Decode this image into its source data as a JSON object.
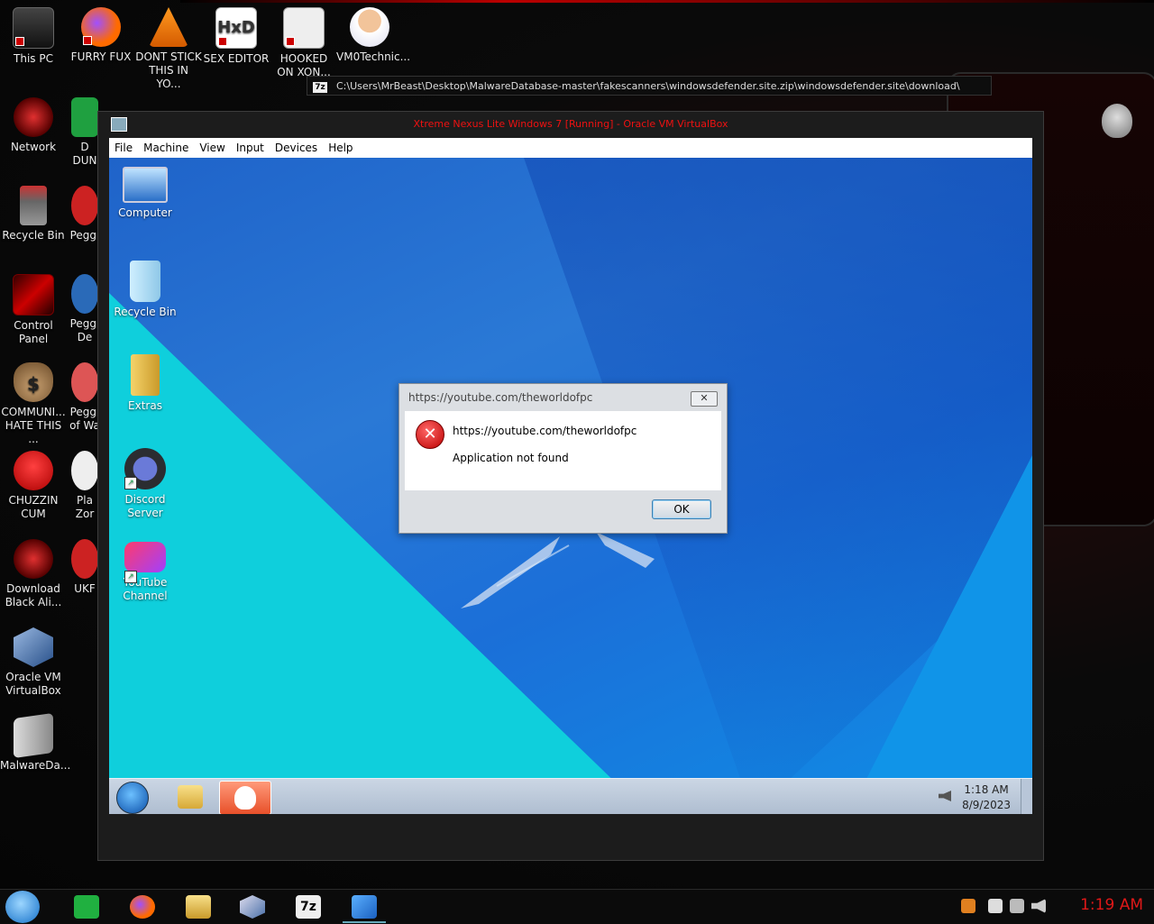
{
  "host": {
    "explorer_path": "C:\\Users\\MrBeast\\Desktop\\MalwareDatabase-master\\fakescanners\\windowsdefender.site.zip\\windowsdefender.site\\download\\",
    "icons_top": [
      {
        "label": "This PC",
        "icon": "monitor-icon",
        "color": "#aa2020"
      },
      {
        "label": "FURRY FUX",
        "icon": "firefox-icon",
        "color": "#ff6a00"
      },
      {
        "label": "DONT STICK THIS IN YO...",
        "icon": "vlc-icon",
        "color": "#ff8800"
      },
      {
        "label": "SEX EDITOR",
        "icon": "hxd-icon",
        "color": "#33aa55"
      },
      {
        "label": "HOOKED ON XON...",
        "icon": "app-icon",
        "color": "#888888"
      },
      {
        "label": "VM0Technic...",
        "icon": "doctor-icon",
        "color": "#f0c080"
      }
    ],
    "icons_left": [
      {
        "label": "Network",
        "icon": "alienware-icon"
      },
      {
        "label": "Recycle Bin",
        "icon": "trash-icon"
      },
      {
        "label": "Control Panel",
        "icon": "control-panel-icon"
      },
      {
        "label": "COMMUNI... HATE THIS ...",
        "icon": "money-bag-icon"
      },
      {
        "label": "CHUZZIN CUM",
        "icon": "chuzzle-icon"
      },
      {
        "label": "Download Black Ali...",
        "icon": "alienware-icon"
      },
      {
        "label": "Oracle VM VirtualBox",
        "icon": "virtualbox-icon"
      },
      {
        "label": "MalwareDa...",
        "icon": "folder-icon"
      }
    ],
    "icons_left2": [
      {
        "label": "D DUN"
      },
      {
        "label": "Peggl"
      },
      {
        "label": "Peggl De"
      },
      {
        "label": "Peggl of Wa"
      },
      {
        "label": "Pla Zor"
      },
      {
        "label": "UKF"
      }
    ],
    "taskbar_clock": "1:19 AM",
    "taskbar_items": [
      "notes-icon",
      "firefox-icon",
      "folder-icon",
      "virtualbox-icon",
      "7zip-icon",
      "win7-icon"
    ]
  },
  "vm": {
    "title": "Xtreme Nexus Lite Windows 7 [Running] - Oracle VM VirtualBox",
    "menu": [
      "File",
      "Machine",
      "View",
      "Input",
      "Devices",
      "Help"
    ]
  },
  "guest": {
    "icons": [
      {
        "label": "Computer",
        "icon": "computer-icon"
      },
      {
        "label": "Recycle Bin",
        "icon": "recycle-bin-icon"
      },
      {
        "label": "Extras",
        "icon": "folder-icon"
      },
      {
        "label": "Discord Server",
        "icon": "discord-icon"
      },
      {
        "label": "YouTube Channel",
        "icon": "youtube-icon"
      }
    ],
    "clock_time": "1:18 AM",
    "clock_date": "8/9/2023"
  },
  "dialog": {
    "title": "https://youtube.com/theworldofpc",
    "line1": "https://youtube.com/theworldofpc",
    "line2": "Application not found",
    "ok_label": "OK",
    "close_symbol": "✕"
  }
}
